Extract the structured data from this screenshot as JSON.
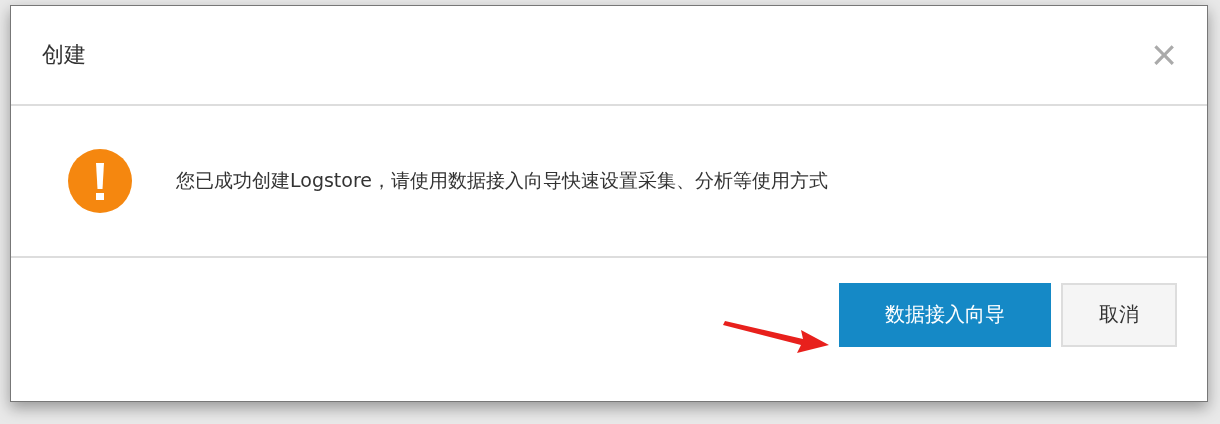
{
  "dialog": {
    "title": "创建",
    "close": "×",
    "message": "您已成功创建Logstore，请使用数据接入向导快速设置采集、分析等使用方式",
    "buttons": [
      {
        "label": "数据接入向导",
        "kind": "primary"
      },
      {
        "label": "取消",
        "kind": "secondary"
      }
    ]
  }
}
